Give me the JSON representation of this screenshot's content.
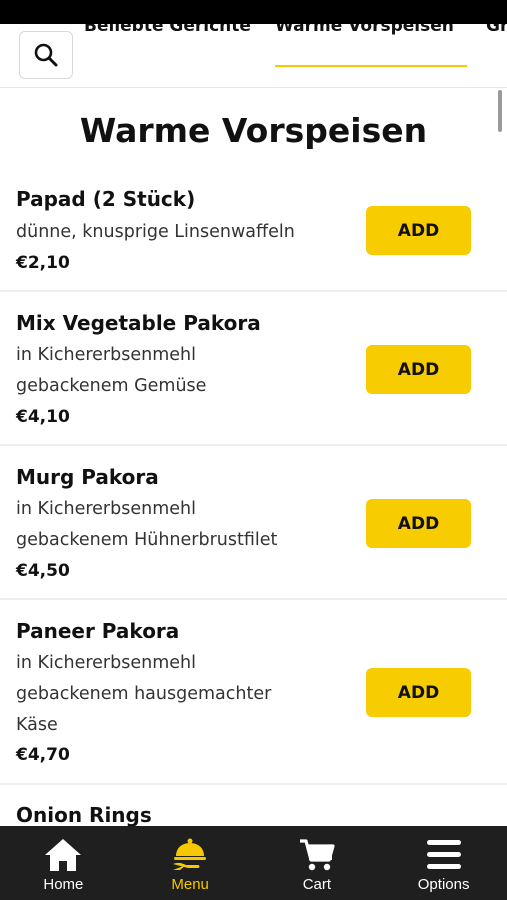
{
  "header": {
    "categories": [
      "Beliebte Gerichte",
      "Warme Vorspeisen",
      "Gr"
    ],
    "active_category": "Warme Vorspeisen",
    "search_icon": "search-icon"
  },
  "section": {
    "title": "Warme Vorspeisen"
  },
  "items": [
    {
      "name": "Papad (2 Stück)",
      "desc_lines": [
        "dünne, knusprige Linsenwaffeln"
      ],
      "price": "€2,10",
      "button": "ADD"
    },
    {
      "name": "Mix Vegetable Pakora",
      "desc_lines": [
        "in Kichererbsenmehl",
        "gebackenem Gemüse"
      ],
      "price": "€4,10",
      "button": "ADD"
    },
    {
      "name": "Murg Pakora",
      "desc_lines": [
        "in Kichererbsenmehl",
        "gebackenem Hühnerbrustfilet"
      ],
      "price": "€4,50",
      "button": "ADD"
    },
    {
      "name": "Paneer Pakora",
      "desc_lines": [
        "in Kichererbsenmehl",
        "gebackenem hausgemachter",
        "Käse"
      ],
      "price": "€4,70",
      "button": "ADD"
    },
    {
      "name": "Onion Rings",
      "desc_lines": [],
      "price": "",
      "button": ""
    }
  ],
  "nav": [
    {
      "label": "Home",
      "icon": "home-icon",
      "active": false
    },
    {
      "label": "Menu",
      "icon": "menu-cloche-icon",
      "active": true
    },
    {
      "label": "Cart",
      "icon": "cart-icon",
      "active": false
    },
    {
      "label": "Options",
      "icon": "options-hamburger-icon",
      "active": false
    }
  ],
  "colors": {
    "accent": "#f7cc00",
    "nav_background": "#1f1f1f",
    "active_nav": "#f5c800"
  }
}
